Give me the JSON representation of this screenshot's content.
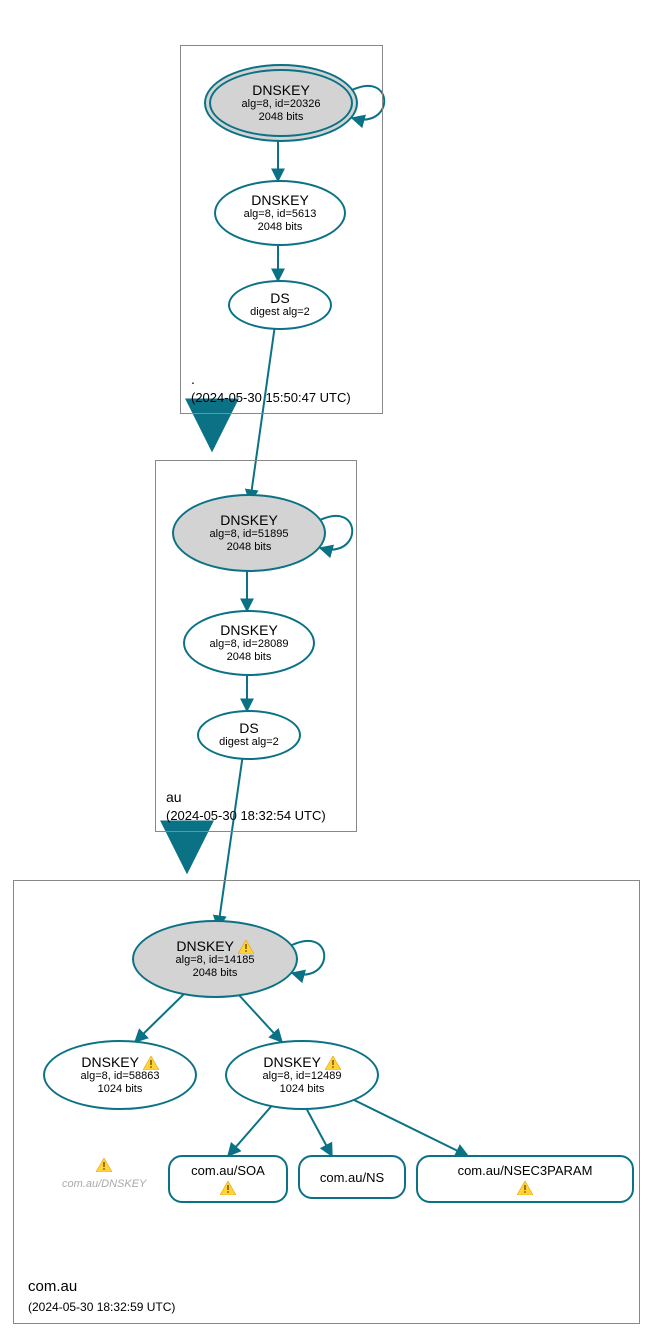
{
  "zones": {
    "root": {
      "label": ".",
      "time": "(2024-05-30 15:50:47 UTC)"
    },
    "au": {
      "label": "au",
      "time": "(2024-05-30 18:32:54 UTC)"
    },
    "comau": {
      "label": "com.au",
      "time": "(2024-05-30 18:32:59 UTC)"
    }
  },
  "nodes": {
    "root_ksk": {
      "title": "DNSKEY",
      "line1": "alg=8, id=20326",
      "line2": "2048 bits"
    },
    "root_zsk": {
      "title": "DNSKEY",
      "line1": "alg=8, id=5613",
      "line2": "2048 bits"
    },
    "root_ds": {
      "title": "DS",
      "line1": "digest alg=2"
    },
    "au_ksk": {
      "title": "DNSKEY",
      "line1": "alg=8, id=51895",
      "line2": "2048 bits"
    },
    "au_zsk": {
      "title": "DNSKEY",
      "line1": "alg=8, id=28089",
      "line2": "2048 bits"
    },
    "au_ds": {
      "title": "DS",
      "line1": "digest alg=2"
    },
    "comau_ksk": {
      "title": "DNSKEY",
      "line1": "alg=8, id=14185",
      "line2": "2048 bits"
    },
    "comau_z1": {
      "title": "DNSKEY",
      "line1": "alg=8, id=58863",
      "line2": "1024 bits"
    },
    "comau_z2": {
      "title": "DNSKEY",
      "line1": "alg=8, id=12489",
      "line2": "1024 bits"
    }
  },
  "rr": {
    "soa": "com.au/SOA",
    "ns": "com.au/NS",
    "nsec3": "com.au/NSEC3PARAM"
  },
  "dangling": "com.au/DNSKEY"
}
